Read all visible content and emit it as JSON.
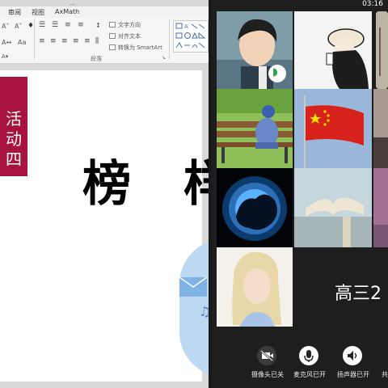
{
  "window": {
    "title": "...",
    "time": "03:16"
  },
  "ppt": {
    "menu": [
      "审阅",
      "视图",
      "AxMath"
    ],
    "ribbon": {
      "text_direction": "文字方向",
      "align_text": "对齐文本",
      "convert_smartart": "转换为 SmartArt",
      "group_label": "段落"
    },
    "slide": {
      "activity_label": "活动四",
      "title": "榜 样"
    }
  },
  "meeting": {
    "participant_name": "高三2",
    "controls": [
      {
        "label": "摄像头已关",
        "icon": "camera-off-icon"
      },
      {
        "label": "麦克风已开",
        "icon": "microphone-icon"
      },
      {
        "label": "扬声器已开",
        "icon": "speaker-icon"
      },
      {
        "label": "共",
        "icon": "share-icon"
      }
    ]
  }
}
